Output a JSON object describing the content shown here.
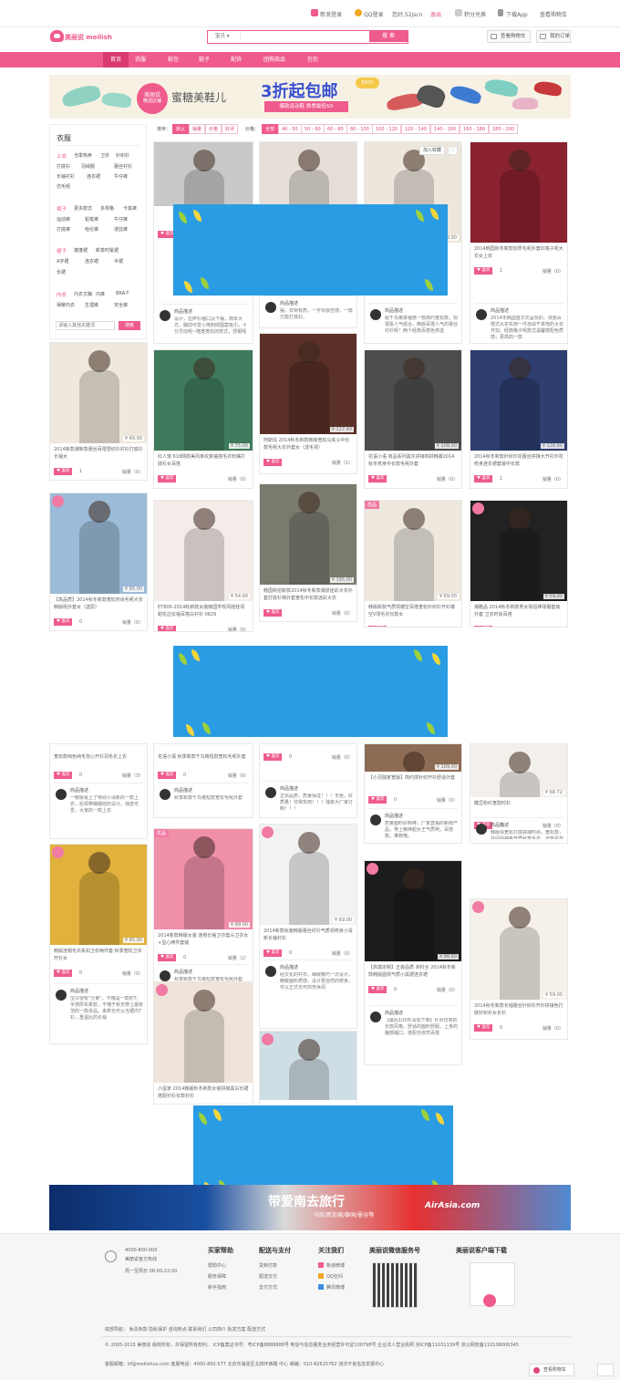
{
  "topbar": {
    "sina_login": "新浪登录",
    "qq_login": "QQ登录",
    "user": "您好,52jscn",
    "logout": "退出",
    "points": "积分兑换",
    "app": "下载App",
    "order": "查看购物车"
  },
  "header": {
    "logo": "美丽说 meilishuo.com",
    "search_category": "宝贝",
    "search_placeholder": "",
    "search_button": "搜 索",
    "cart_button": "查看购物车",
    "orders_button": "我的订单"
  },
  "nav": [
    "首页",
    "衣服",
    "鞋包",
    "鞋子",
    "配饰",
    "团购商品",
    "包包"
  ],
  "banner1": {
    "badge_line1": "美丽说",
    "badge_line2": "精选店铺",
    "slogan": "蜜糖美鞋儿",
    "promo": "3折起包邮",
    "promo_sub": "爆款运动鞋  换季最低SO",
    "easy": "EASY"
  },
  "sidebar": {
    "title": "衣服",
    "groups": [
      {
        "name": "上衣",
        "items": [
          "当季热卖",
          "卫衣",
          "针织衫",
          "打底衫",
          "羽绒服",
          "蕾丝衬衫",
          "长袖衬衫",
          "连衣裙",
          "牛仔裤",
          "仿毛呢"
        ]
      },
      {
        "name": "裤子",
        "items": [
          "更多款式",
          "多规格",
          "卡其裤",
          "运动裤",
          "铅笔裤",
          "牛仔裤",
          "打底裤",
          "哈伦裤",
          "漫剪裤"
        ]
      },
      {
        "name": "裙子",
        "items": [
          "蓬蓬裙",
          "新季时髦裙",
          "A字裙",
          "连衣裙",
          "半裙",
          "长裙"
        ]
      },
      {
        "name": "内衣",
        "items": [
          "内衣文胸",
          "内裤",
          "BRA-T",
          "保暖内衣",
          "生理裤",
          "安全裤"
        ]
      }
    ],
    "search_placeholder": "请输入其他关键词",
    "search_button": "搜索"
  },
  "filter": {
    "sort_label": "排序：",
    "sorts": [
      "默认",
      "销量",
      "价格",
      "好评"
    ],
    "price_label": "价格：",
    "prices": [
      "全部",
      "40 - 50",
      "50 - 60",
      "60 - 80",
      "80 - 100",
      "100 - 120",
      "120 - 140",
      "140 - 160",
      "160 - 180",
      "180 - 200"
    ]
  },
  "product": {
    "like": "喜欢",
    "sales_prefix": "销量",
    "desc_label": "商品描述",
    "add_fav": "加入收藏"
  },
  "cards": [
    {
      "title": "",
      "price": "",
      "likes": "",
      "sales": "",
      "desc": "设计，拉萨衫袖口及下摆，简单大方，胸前可爱小熊刺绣图案吸引，十分灵动呢~略宽宽松的款式，舒服呢"
    },
    {
      "title": "",
      "price": "",
      "likes": "",
      "sales": "",
      "desc": "摆，非常有质，一字领很性感，一款万能打底衫。"
    },
    {
      "title": "",
      "price": "¥ 53.00",
      "likes": "",
      "sales": "",
      "desc": "配千鸟格率袖搭一款简约宽松款，现很看人气组合，韩版百搭人气的蕾丝衬衫呢！两个经典百搭色供选"
    },
    {
      "title": "2014韩国秋冬新款加厚毛呢外套红格子呢大衣女上衣",
      "price": "",
      "likes": "1",
      "sales": "销量（0）",
      "desc": "2014年韩国首次次呈现的，诱惑百搭式大衣实用一件自由千率地的大衣开扣。经典格子呢款式温馨搭配色质感，更高的一款"
    },
    {
      "title": "2014新款潮新款蕾丝百褶雪纺衫衬衫打底衫长袖女",
      "price": "¥ 49.00",
      "likes": "1",
      "sales": "销量（0）"
    },
    {
      "title": "红人馆 618网款美风条纹复袖搭毛衣粉嘴打底衫女百搭",
      "price": "¥ 75.00",
      "likes": "",
      "sales": "销量（0）"
    },
    {
      "title": "阿斯玛 2014秋冬新款韩版宽松马夹斗中长款毛呢大衣外套女（送毛领）",
      "price": "¥ 117.40",
      "likes": "",
      "sales": "销量（1）"
    },
    {
      "title": "花语小语 商品系列黑灰拼接四拼韩版2014秋冬修身中长款毛呢外套",
      "price": "¥ 108.00",
      "likes": "",
      "sales": "销量（0）"
    },
    {
      "title": "2014秋冬新款针织印花蕾丝拼接大开衫印花修身连衣裙套装中长款",
      "price": "¥ 128.00",
      "likes": "1",
      "sales": "销量（0）"
    },
    {
      "title": "【高品质】2014秋冬新款宽松时尚毛呢大衣韩版呢外套女（送原）",
      "price": "¥ 95.00",
      "likes": "0",
      "sales": "销量（0）"
    },
    {
      "title": "ET806-2014秋新款女装韩国学校风娃娃领甜花边长袖百搭白衬衫 0829",
      "price": "¥ 54.00",
      "likes": "",
      "sales": "销量（0）"
    },
    {
      "title": "韩国街拍新款2014秋冬新款潮流迷彩大衣外套打底衫棉外套宽松中长款迷彩大衣",
      "price": "¥ 195.00",
      "likes": "",
      "sales": "销量（0）"
    },
    {
      "title": "韩版新款气质领镂空百搭宽松针织衫开衫镂空V领毛衣长款女",
      "price": "¥ 69.00",
      "likes": "0",
      "sales": "销量（0）"
    },
    {
      "title": "潮酷品 2014秋冬新款男女情侣棒球服套装外套 卫衣时尚百搭",
      "price": "¥ 59.00",
      "likes": "0",
      "sales": "销量（0）"
    },
    {
      "title": "宽松款纯色纯毛背心开衫羽毛衣上衣",
      "price": "",
      "likes": "0",
      "sales": "销量（3）",
      "desc": "一眼就看上了特别小清新的一款上衣，后领带蝴蝶结的设计，俏皮可爱，大家的一款上衣"
    },
    {
      "title": "花语小语 秋季新款千鸟格短款宽松毛呢外套",
      "price": "",
      "likes": "0",
      "sales": "销量（0）",
      "desc": "秋季新款千鸟格短款宽松毛呢外套"
    },
    {
      "title": "",
      "price": "",
      "likes": "0",
      "sales": "销量（0）",
      "desc": "正宗品质，质量保证！！！无色，好质量！非常实用！！！独家大厂家订制！！！"
    },
    {
      "title": "【小羽独家宽版】简约感针织开衫舒适外套",
      "price": "¥ 109.00",
      "likes": "0",
      "sales": "销量（0）",
      "desc": "质量面料好到棒，厂家直销的新鲜产品，穿上精神超女王气质咧，百搭款，推荐哦。"
    },
    {
      "title": "糖豆粉红宽款时衫",
      "price": "¥ 66.72",
      "likes": "0",
      "sales": "销量（0）",
      "desc": "韩版领宽松打底拼接时尚，宽松款，并间中袖备气质秋季毛衣，不管是单穿还是搭配外套都极衣服都是不错的选择哦。"
    },
    {
      "title": "韩版连帽毛衣系扣卫衣两件套 秋季宽松卫衣开衫女",
      "price": "¥ 95.00",
      "likes": "0",
      "sales": "销量（0）",
      "desc": "宝贝很有\"分量\"，不愧是一款的T，手感厚实柔软，不愧于秋天穿上最有范的一款单品。来疯也可以当裙内T衫，重温比的长袖"
    },
    {
      "title": "2014新款韩版女装 连帽长袖卫衣套头卫衣女+显心两件套装",
      "price": "¥ 89.00",
      "likes": "0",
      "sales": "销量（2）",
      "desc": "秋季新款千鸟格短款宽松毛呢外套"
    },
    {
      "title": "2014新款秋装韩版蕾丝衬衫气质领修身小清新长袖衬衫",
      "price": "¥ 69.00",
      "likes": "0",
      "sales": "销量（0）",
      "desc": "经文化的衬衣，细致精巧一次设计，精致面料质感，设计更自然的修身，可以正式也可商务休闲"
    },
    {
      "title": "【高端定制】正装品质 资料全 2014秋冬新款韩版圆领气质小黑裙连衣裙",
      "price": "¥ 96.60",
      "likes": "0",
      "sales": "销量（0）",
      "desc": "【最后100件清完下架】针对日常的长款风格、舒适的面料舒服，上身的胸部袖口，搭配也依然百搭"
    },
    {
      "title": "2014秋冬新款长袖蕾丝针织衫开衫拼接色打底针织衫女长衫",
      "price": "¥ 59.00",
      "likes": "0",
      "sales": "销量（0）"
    },
    {
      "title": "小蛋家 2014韩版秋冬新款女装拼接黑白长裙搭配衬衫长款衬衫",
      "price": "",
      "likes": "",
      "sales": ""
    },
    {
      "title": "",
      "price": "",
      "likes": "",
      "sales": ""
    }
  ],
  "footer": {
    "phone": "4000-800-000",
    "phone_note": "美丽说官方热线",
    "hours": "周一至周日 08:00-22:00",
    "cols": [
      {
        "title": "买家帮助",
        "items": [
          "帮助中心",
          "服务保障",
          "新手指南"
        ]
      },
      {
        "title": "配送与支付",
        "items": [
          "货到付款",
          "配送支付",
          "支付方式"
        ]
      },
      {
        "title": "关注我们",
        "items": [
          "新浪微博",
          "QQ空间",
          "腾讯微博"
        ]
      },
      {
        "title": "美丽说微信服务号",
        "items": []
      },
      {
        "title": "美丽说客户端下载",
        "items": []
      }
    ],
    "links": "底部导航：  免责条款   隐私保护   咨询热点   联系我们   公司简介   批发方案   配送方式",
    "copyright": "© 2005-2015 美丽说 版权所有，并保留所有权利。  ICP备案证书号：粤ICP备8888888号   电信与信息服务业务经营许可证100798号   企业法人营业执照   京ICP备11031139号  京公网安备110108006345",
    "contact": "客服邮箱：kf@meilishuo.com   客服电话：4000-800-577  北京市海淀区北四环西路 中心 邮编：010-82615762  违法不良信息举报中心",
    "float_cart": "查看购物车"
  },
  "banner2": {
    "text": "带爱南去旅行",
    "sub": "马航/新加坡/泰国/曼谷等",
    "brand": "AirAsia.com"
  }
}
